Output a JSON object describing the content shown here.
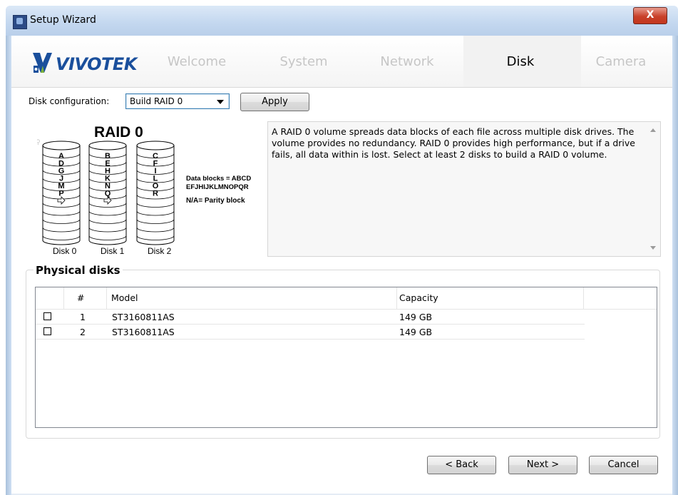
{
  "window": {
    "title": "Setup Wizard",
    "close_glyph": "X"
  },
  "logo": {
    "text": "VIVOTEK",
    "brand_color": "#1a4f9c"
  },
  "nav": {
    "tabs": [
      {
        "label": "Welcome"
      },
      {
        "label": "System"
      },
      {
        "label": "Network"
      },
      {
        "label": "Disk"
      },
      {
        "label": "Camera"
      }
    ],
    "active": "Disk"
  },
  "config": {
    "label": "Disk configuration:",
    "selected": "Build RAID 0",
    "apply_label": "Apply"
  },
  "raid_diagram": {
    "title": "RAID 0",
    "disks": [
      {
        "label": "Disk 0",
        "blocks": [
          "A",
          "D",
          "G",
          "J",
          "M",
          "P"
        ]
      },
      {
        "label": "Disk 1",
        "blocks": [
          "B",
          "E",
          "H",
          "K",
          "N",
          "Q"
        ]
      },
      {
        "label": "Disk 2",
        "blocks": [
          "C",
          "F",
          "I",
          "L",
          "O",
          "R"
        ]
      }
    ],
    "legend_line1": "Data blocks = ABCD",
    "legend_line2": "EFJHIJKLMNOPQR",
    "legend_line3": "N/A= Parity block"
  },
  "description": "A RAID 0 volume spreads data blocks of each file across multiple disk drives. The volume provides no redundancy. RAID 0 provides high performance, but if a drive fails, all data within is lost. Select at least 2 disks to build a RAID 0 volume.",
  "physical_disks": {
    "title": "Physical disks",
    "columns": {
      "num": "#",
      "model": "Model",
      "capacity": "Capacity"
    },
    "rows": [
      {
        "num": "1",
        "model": "ST3160811AS",
        "capacity": "149 GB"
      },
      {
        "num": "2",
        "model": "ST3160811AS",
        "capacity": "149 GB"
      }
    ]
  },
  "footer": {
    "back_label": "< Back",
    "next_label": "Next >",
    "cancel_label": "Cancel"
  }
}
